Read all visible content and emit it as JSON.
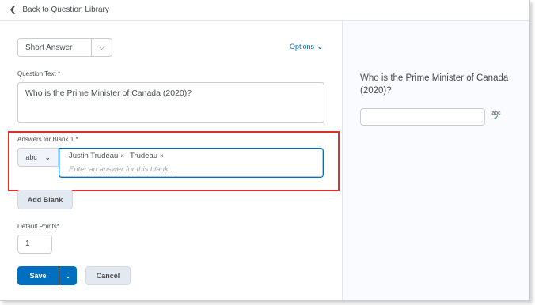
{
  "header": {
    "back_icon": "chevron-left-icon",
    "back_label": "Back to Question Library"
  },
  "editor": {
    "question_type": "Short Answer",
    "options_label": "Options",
    "question_text_label": "Question Text",
    "question_text_value": "Who is the Prime Minister of Canada (2020)?",
    "blank_label": "Answers for Blank 1",
    "answer_type": "abc",
    "answers": [
      "Justin Trudeau",
      "Trudeau"
    ],
    "answer_placeholder": "Enter an answer for this blank...",
    "add_blank_label": "Add Blank",
    "default_points_label": "Default Points",
    "default_points_value": "1",
    "save_label": "Save",
    "cancel_label": "Cancel",
    "required_marker": "*",
    "tag_remove_glyph": "×"
  },
  "preview": {
    "question_text": "Who is the Prime Minister of Canada (2020)?",
    "spellcheck_icon": "spellcheck-icon",
    "spellcheck_text": "abc"
  },
  "colors": {
    "primary": "#006fbf",
    "highlight": "#d9312b",
    "preview_bg": "#f9fbff"
  }
}
